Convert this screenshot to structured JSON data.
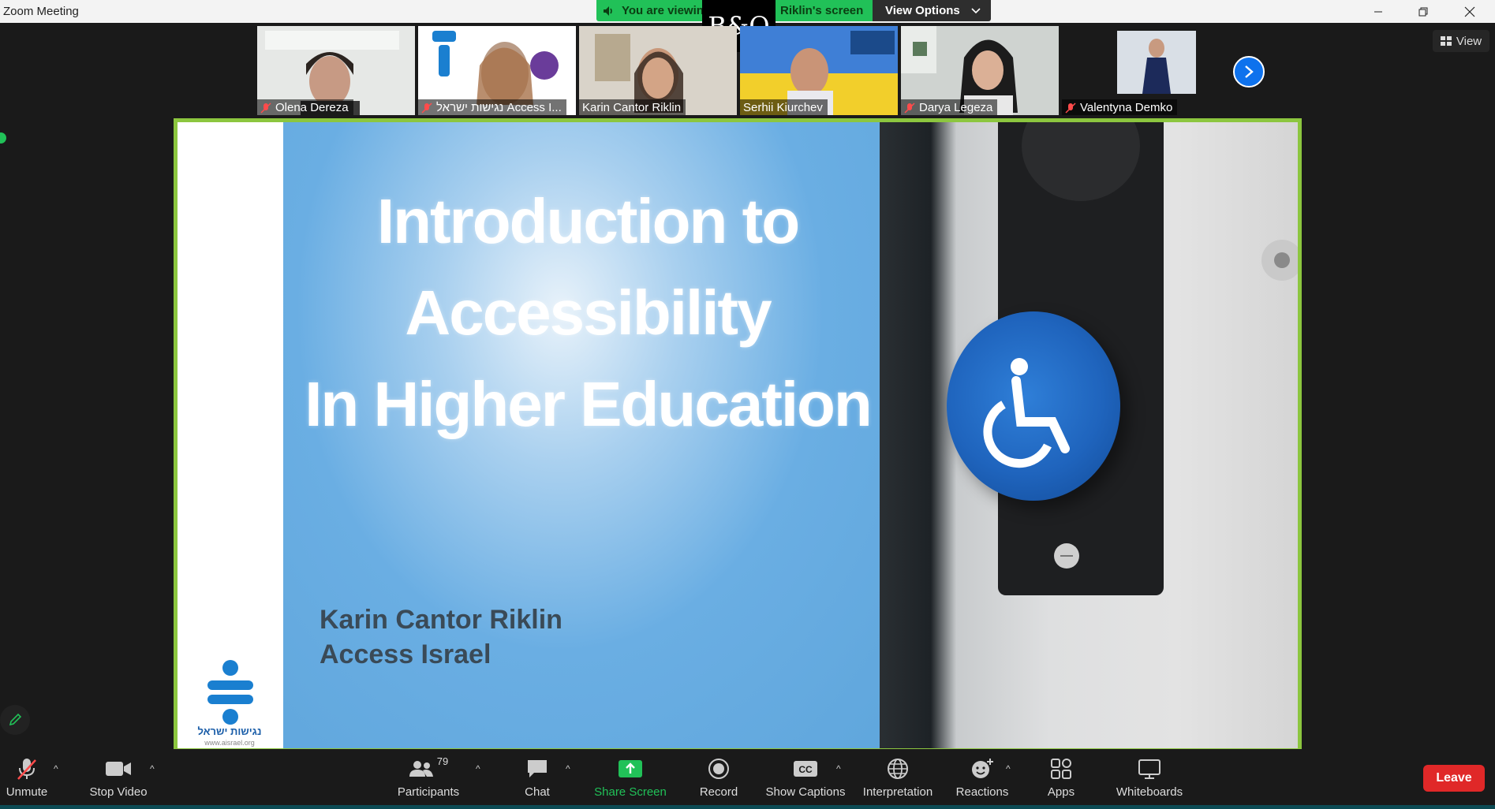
{
  "window": {
    "title": "Zoom Meeting"
  },
  "banner": {
    "viewing_left": "You are viewing",
    "viewing_right": "Riklin's screen",
    "view_options": "View Options",
    "center_logo": "B&O"
  },
  "participants_strip": [
    {
      "name": "Olena Dereza",
      "muted": true
    },
    {
      "name": "נגישות ישראל Access I...",
      "muted": true
    },
    {
      "name": "Karin Cantor Riklin",
      "muted": false
    },
    {
      "name": "Serhii Kiurchev",
      "muted": false
    },
    {
      "name": "Darya Legeza",
      "muted": true
    },
    {
      "name": "Valentyna Demko",
      "muted": true
    }
  ],
  "view_button": "View",
  "slide": {
    "title_lines": [
      "Introduction to",
      "Accessibility",
      "In Higher Education"
    ],
    "presenter": "Karin Cantor Riklin",
    "org": "Access Israel",
    "logo_text": "נגישות ישראל",
    "logo_url": "www.aisrael.org"
  },
  "toolbar": {
    "unmute": "Unmute",
    "stop_video": "Stop Video",
    "participants": "Participants",
    "participants_count": "79",
    "chat": "Chat",
    "share_screen": "Share Screen",
    "record": "Record",
    "show_captions": "Show Captions",
    "interpretation": "Interpretation",
    "reactions": "Reactions",
    "apps": "Apps",
    "whiteboards": "Whiteboards",
    "leave": "Leave"
  },
  "colors": {
    "accent_green": "#21c158",
    "share_border": "#8cc63f",
    "leave_red": "#e02828",
    "zoom_blue": "#0e72ed"
  }
}
